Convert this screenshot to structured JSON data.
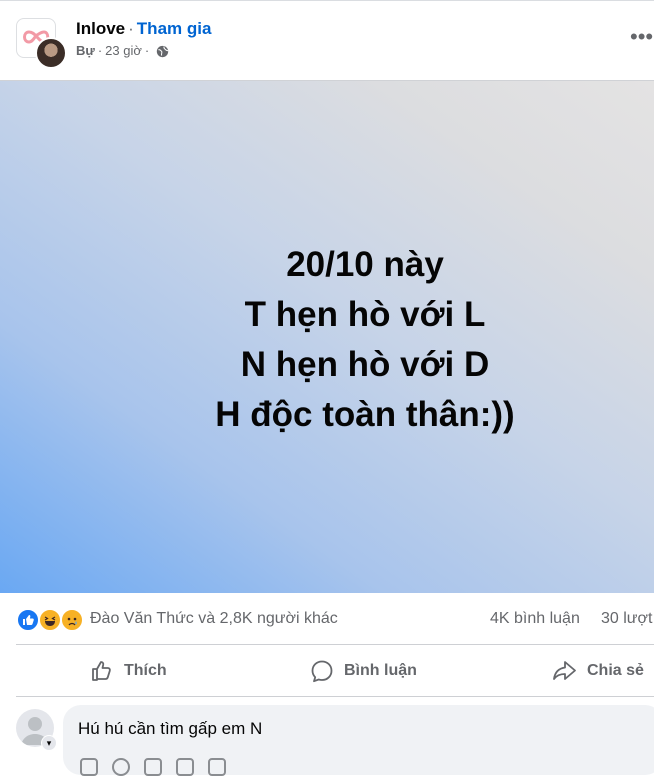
{
  "header": {
    "group_name": "Inlove",
    "separator": "·",
    "join_label": "Tham gia",
    "author": "Bự",
    "time": "23 giờ",
    "meta_sep": "·",
    "more_label": "•••"
  },
  "post": {
    "lines": [
      "20/10 này",
      "T hẹn hò với L",
      "N hẹn hò với D",
      "H độc toàn thân:))"
    ]
  },
  "reactions": {
    "reactors": "Đào Văn Thức và 2,8K người khác",
    "comments": "4K bình luận",
    "shares": "30 lượt"
  },
  "actions": {
    "like": "Thích",
    "comment": "Bình luận",
    "share": "Chia sẻ"
  },
  "comment_box": {
    "text": "Hú hú cần tìm gấp em N"
  },
  "colors": {
    "accent": "#0064d1",
    "secondary_text": "#65676b",
    "like_blue": "#1877f2"
  },
  "icons": [
    "group-logo-icon",
    "globe-icon",
    "more-icon",
    "like-icon",
    "comment-icon",
    "share-icon"
  ]
}
